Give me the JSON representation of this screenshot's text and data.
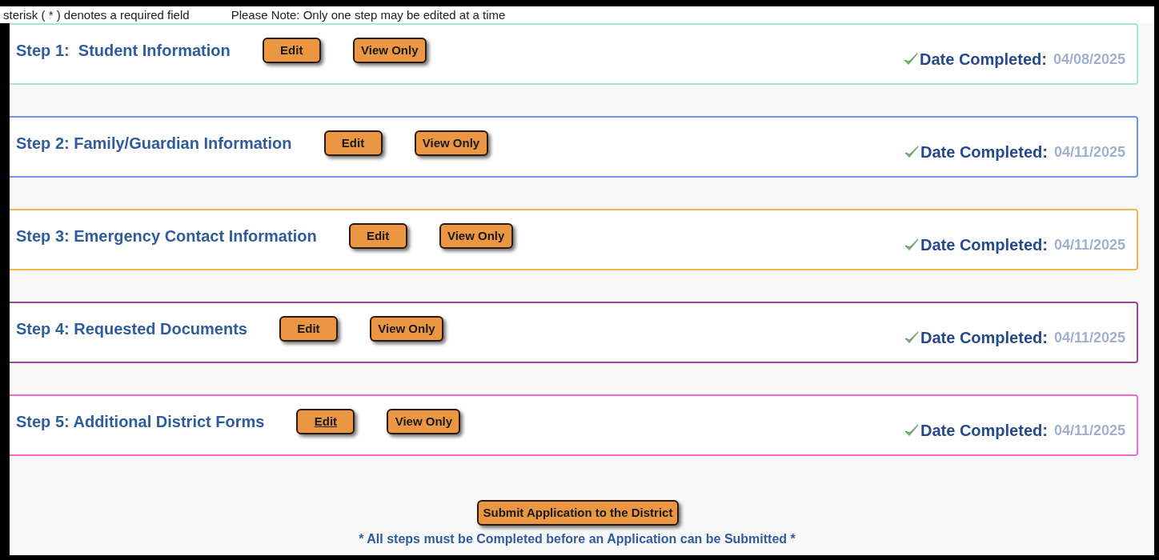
{
  "notices": {
    "required": "sterisk ( * ) denotes a required field",
    "edit_note": "Please Note: Only one step may be edited at a time"
  },
  "steps": [
    {
      "title": "Step 1:  Student Information",
      "color": "#a6e8cc",
      "edit": {
        "label": "Edit",
        "hovered": false
      },
      "view": "View Only",
      "completed_label": "Date Completed:",
      "date": "04/08/2025"
    },
    {
      "title": "Step 2: Family/Guardian Information",
      "color": "#7393e0",
      "edit": {
        "label": "Edit",
        "hovered": false
      },
      "view": "View Only",
      "completed_label": "Date Completed:",
      "date": "04/11/2025"
    },
    {
      "title": "Step 3: Emergency Contact Information",
      "color": "#f2b548",
      "edit": {
        "label": "Edit",
        "hovered": false
      },
      "view": "View Only",
      "completed_label": "Date Completed:",
      "date": "04/11/2025"
    },
    {
      "title": "Step 4: Requested Documents",
      "color": "#9a449e",
      "edit": {
        "label": "Edit",
        "hovered": false
      },
      "view": "View Only",
      "completed_label": "Date Completed:",
      "date": "04/11/2025"
    },
    {
      "title": "Step 5: Additional District Forms",
      "color": "#f06ad6",
      "edit": {
        "label": "Edit",
        "hovered": true
      },
      "view": "View Only",
      "completed_label": "Date Completed:",
      "date": "04/11/2025"
    }
  ],
  "submit": {
    "label": "Submit Application to the District",
    "note": "* All steps must be Completed before an Application can be Submitted *"
  }
}
